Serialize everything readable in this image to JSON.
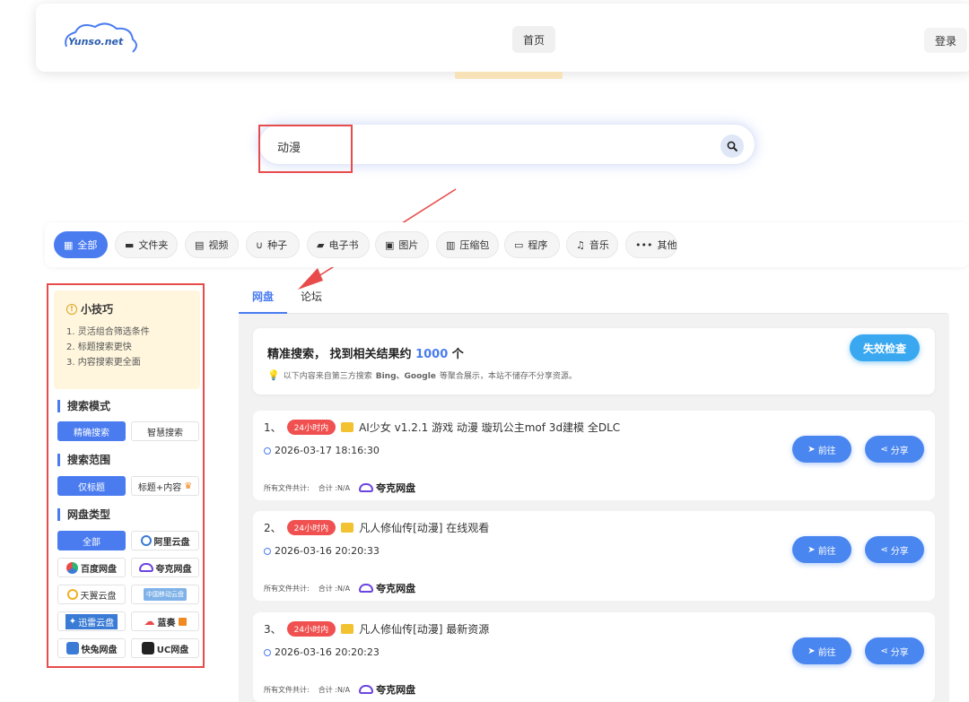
{
  "header": {
    "logo_text": "Yunso.net",
    "nav_home": "首页",
    "login": "登录"
  },
  "search": {
    "value": "动漫"
  },
  "categories": [
    {
      "label": "全部",
      "icon": "grid-icon",
      "active": true
    },
    {
      "label": "文件夹",
      "icon": "folder-icon"
    },
    {
      "label": "视频",
      "icon": "film-icon"
    },
    {
      "label": "种子",
      "icon": "magnet-icon"
    },
    {
      "label": "电子书",
      "icon": "book-icon"
    },
    {
      "label": "图片",
      "icon": "image-icon"
    },
    {
      "label": "压缩包",
      "icon": "archive-icon"
    },
    {
      "label": "程序",
      "icon": "monitor-icon"
    },
    {
      "label": "音乐",
      "icon": "music-icon"
    },
    {
      "label": "其他",
      "icon": "more-icon"
    }
  ],
  "sidebar": {
    "tips": {
      "title": "小技巧",
      "items": [
        "1. 灵活组合筛选条件",
        "2. 标题搜索更快",
        "3. 内容搜索更全面"
      ]
    },
    "search_mode": {
      "title": "搜索模式",
      "options": [
        "精确搜索",
        "智慧搜索"
      ]
    },
    "search_scope": {
      "title": "搜索范围",
      "options": [
        "仅标题",
        "标题+内容"
      ]
    },
    "disk_type": {
      "title": "网盘类型",
      "options": [
        "全部",
        "阿里云盘",
        "百度网盘",
        "夸克网盘",
        "天翼云盘",
        "中国移动云盘",
        "迅雷云盘",
        "蓝奏",
        "快兔网盘",
        "UC网盘"
      ]
    }
  },
  "tabs": [
    "网盘",
    "论坛"
  ],
  "summary": {
    "title_prefix": "精准搜索， 找到相关结果约",
    "count": "1000",
    "title_suffix": "个",
    "note_prefix": "以下内容来自第三方搜索",
    "note_bold": "Bing、Google",
    "note_suffix": "等聚合展示，本站不储存不分享资源。",
    "fail_check": "失效检查"
  },
  "results": [
    {
      "index": "1、",
      "badge": "24小时内",
      "title": "AI少女 v1.2.1 游戏 动漫 璇玑公主mof 3d建模 全DLC",
      "time": "2026-03-17 18:16:30",
      "files_label": "所有文件共计:",
      "total": "合计 :N/A",
      "provider": "夸克网盘",
      "go": "前往",
      "share": "分享"
    },
    {
      "index": "2、",
      "badge": "24小时内",
      "title": "凡人修仙传[动漫] 在线观看",
      "time": "2026-03-16 20:20:33",
      "files_label": "所有文件共计:",
      "total": "合计 :N/A",
      "provider": "夸克网盘",
      "go": "前往",
      "share": "分享"
    },
    {
      "index": "3、",
      "badge": "24小时内",
      "title": "凡人修仙传[动漫] 最新资源",
      "time": "2026-03-16 20:20:23",
      "files_label": "所有文件共计:",
      "total": "合计 :N/A",
      "provider": "夸克网盘",
      "go": "前往",
      "share": "分享"
    }
  ],
  "colors": {
    "accent": "#4a7cf0",
    "badge": "#f05050",
    "highlight_box": "#e84b4b",
    "fail_check": "#3aa8f0"
  }
}
